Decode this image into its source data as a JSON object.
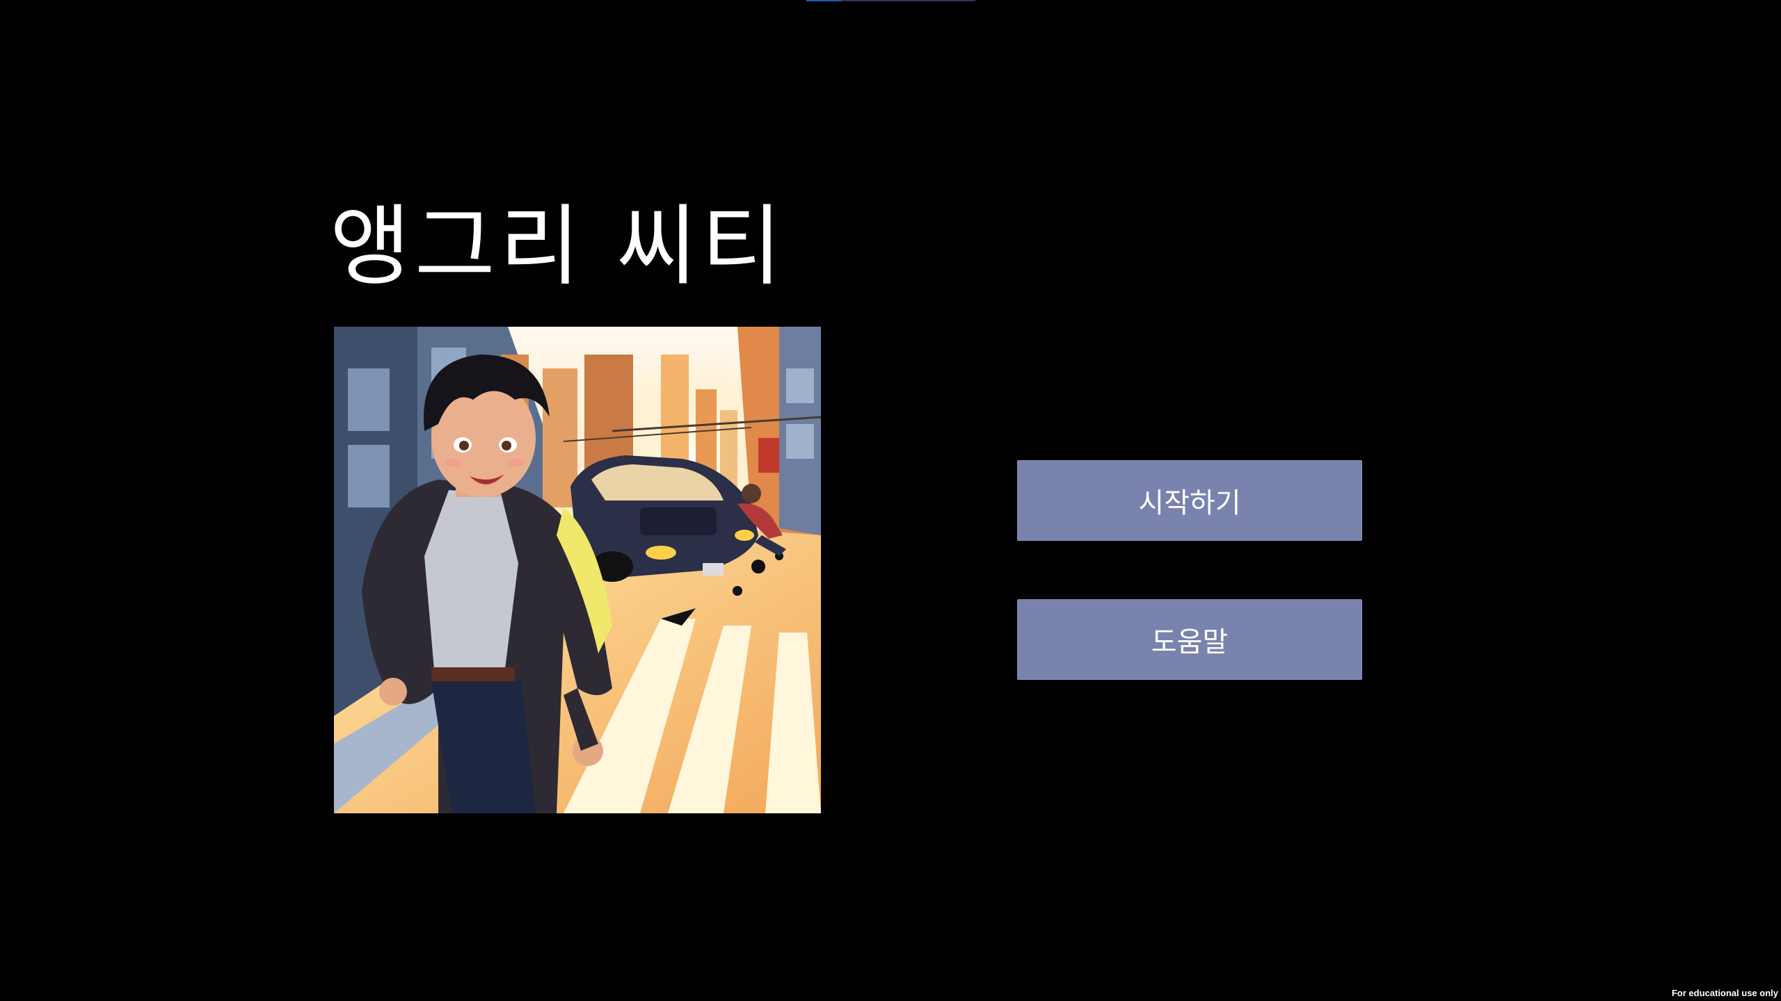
{
  "game": {
    "title": "앵그리 씨티",
    "cover_art": {
      "description_icon": "cover-illustration"
    }
  },
  "menu": {
    "start_label": "시작하기",
    "help_label": "도움말"
  },
  "footer": {
    "note": "For educational use only"
  },
  "colors": {
    "background": "#000000",
    "button_fill": "#7a82ae",
    "text": "#ffffff"
  }
}
